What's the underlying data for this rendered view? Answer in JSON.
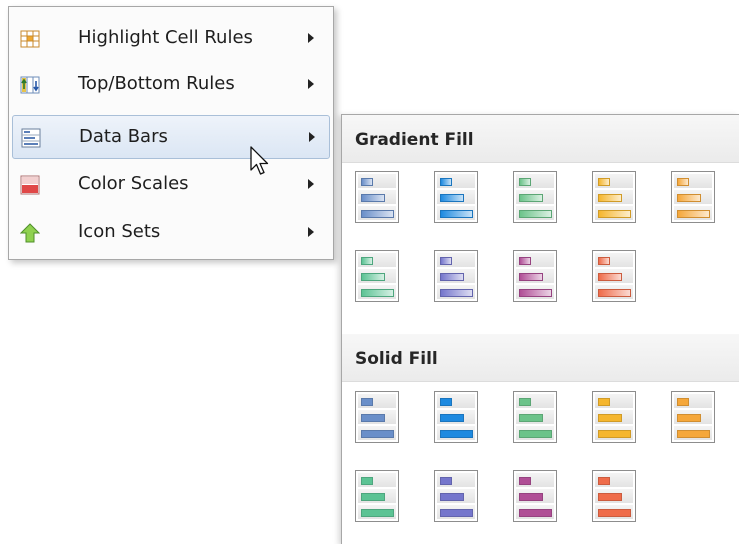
{
  "menu": {
    "items": [
      {
        "label": "Highlight Cell Rules",
        "icon": "highlight-cell-rules-icon",
        "has_submenu": true
      },
      {
        "label": "Top/Bottom Rules",
        "icon": "top-bottom-rules-icon",
        "has_submenu": true
      },
      {
        "label": "Data Bars",
        "icon": "data-bars-icon",
        "has_submenu": true,
        "active": true
      },
      {
        "label": "Color Scales",
        "icon": "color-scales-icon",
        "has_submenu": true
      },
      {
        "label": "Icon Sets",
        "icon": "icon-sets-icon",
        "has_submenu": true
      }
    ]
  },
  "gallery": {
    "groups": [
      {
        "title": "Gradient Fill",
        "style": "gradient",
        "colors": [
          "#6a8fc9",
          "#1e8ae0",
          "#6cc38a",
          "#f5b62e",
          "#f5a73a",
          "#5cc394",
          "#7576cc",
          "#b04f96",
          "#ef6c4a"
        ]
      },
      {
        "title": "Solid Fill",
        "style": "solid",
        "colors": [
          "#6a8fc9",
          "#1e8ae0",
          "#6cc38a",
          "#f5b62e",
          "#f5a73a",
          "#5cc394",
          "#7576cc",
          "#b04f96",
          "#ef6c4a"
        ]
      }
    ]
  }
}
